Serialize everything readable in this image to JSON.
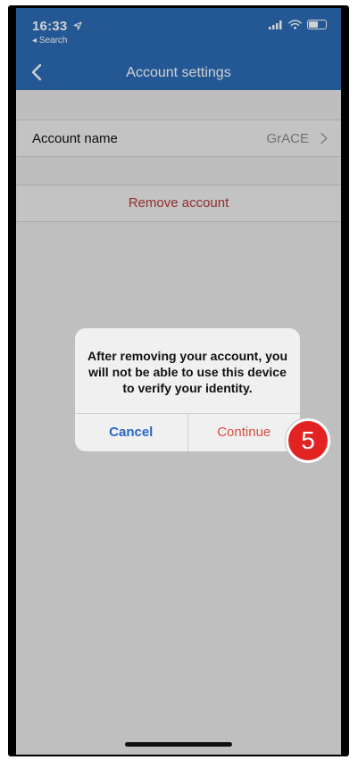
{
  "status_bar": {
    "time": "16:33",
    "back_app": "◂ Search",
    "battery_level_percent": 60
  },
  "nav": {
    "title": "Account settings"
  },
  "account_row": {
    "label": "Account name",
    "value": "GrACE"
  },
  "remove_row": {
    "label": "Remove account"
  },
  "alert": {
    "message": "After removing your account, you will not be able to use this device to verify your identity.",
    "cancel_label": "Cancel",
    "continue_label": "Continue"
  },
  "step_badge": {
    "number": "5"
  },
  "icons": {
    "back": "chevron-left-icon",
    "location": "location-arrow-icon",
    "signal": "signal-icon",
    "wifi": "wifi-icon",
    "battery": "battery-icon",
    "chevron": "chevron-right-icon"
  },
  "colors": {
    "nav_bar": "#2b6cb5",
    "remove_text": "#b23a3a",
    "cancel_text": "#2a66c6",
    "continue_text": "#d94b3f",
    "badge": "#e32222"
  }
}
